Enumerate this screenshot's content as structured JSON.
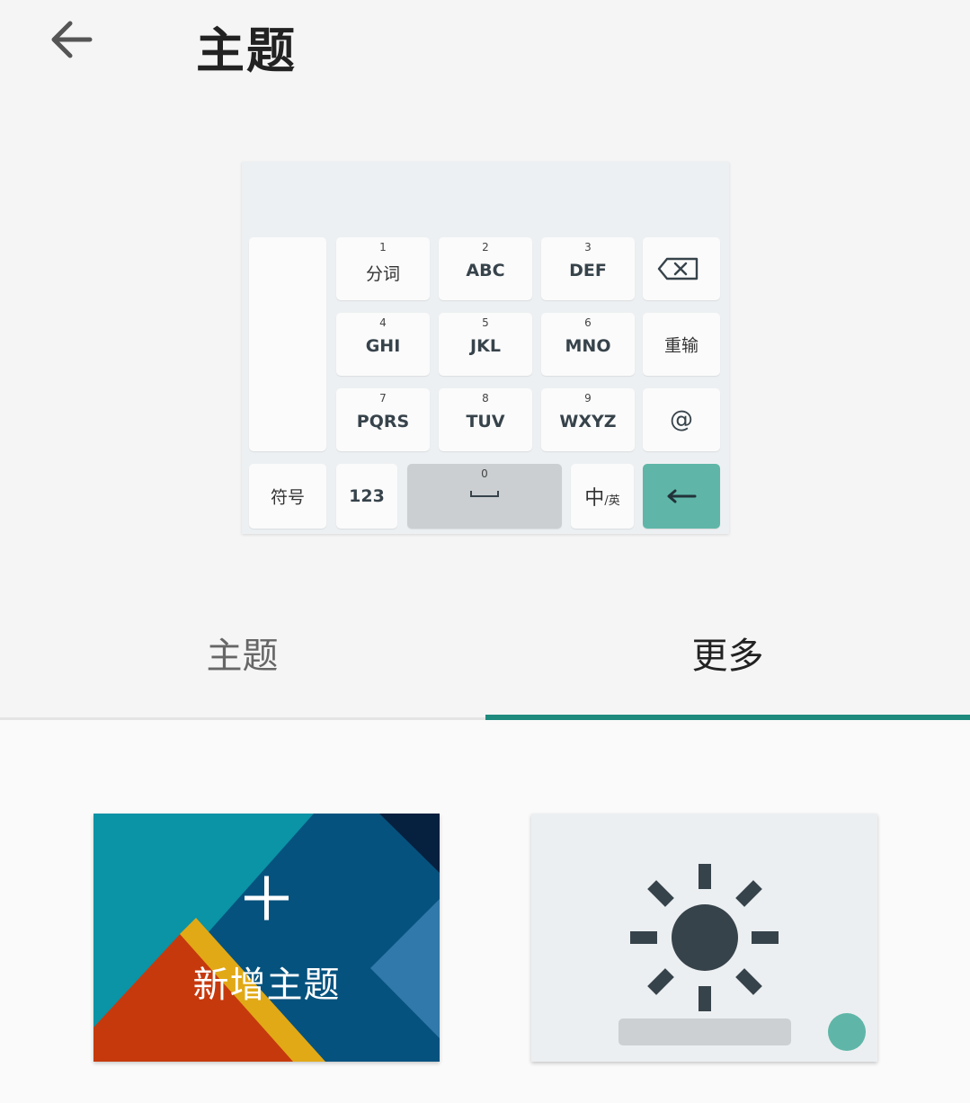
{
  "header": {
    "title": "主题"
  },
  "keyboard_preview": {
    "rows": [
      [
        {
          "num": "1",
          "label": "分词",
          "cn": true
        },
        {
          "num": "2",
          "label": "ABC"
        },
        {
          "num": "3",
          "label": "DEF"
        }
      ],
      [
        {
          "num": "4",
          "label": "GHI"
        },
        {
          "num": "5",
          "label": "JKL"
        },
        {
          "num": "6",
          "label": "MNO"
        }
      ],
      [
        {
          "num": "7",
          "label": "PQRS"
        },
        {
          "num": "8",
          "label": "TUV"
        },
        {
          "num": "9",
          "label": "WXYZ"
        }
      ]
    ],
    "reinput_label": "重输",
    "at_label": "@",
    "symbol_label": "符号",
    "num_label": "123",
    "space_num": "0",
    "lang_main": "中",
    "lang_sub": "/英",
    "accent_color": "#5fb6a8"
  },
  "tabs": [
    {
      "label": "主题",
      "selected": false
    },
    {
      "label": "更多",
      "selected": true
    }
  ],
  "cards": {
    "new_theme_label": "新增主题",
    "brightness_icon": "brightness-icon"
  },
  "colors": {
    "indicator": "#1e8a7e",
    "teal": "#5fb6a8"
  }
}
